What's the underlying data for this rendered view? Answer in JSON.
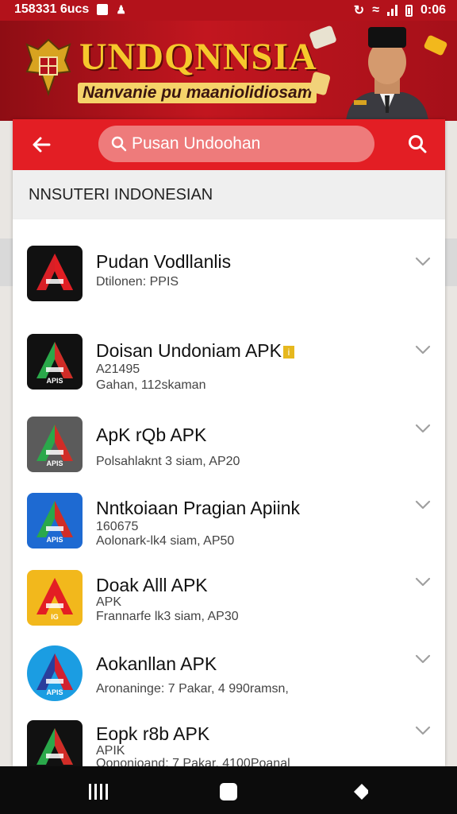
{
  "status_bar": {
    "left_text": "158331 6ucs",
    "time": "0:06"
  },
  "banner": {
    "title": "UNDQNNSIA",
    "subtitle": "Nanvanie pu maaniolidiosam"
  },
  "search": {
    "text": "Pusan Undoohan"
  },
  "section_header": "NNSUTERI INDONESIAN",
  "apps": [
    {
      "name": "Pudan Vodllanlis",
      "meta1": "Dtilonen: PPIS",
      "meta2": "",
      "badge": "",
      "icon_colors": [
        "#111111",
        "#d81f26"
      ],
      "icon_text": ""
    },
    {
      "name": "Doisan Undoniam APK",
      "meta1": "A21495",
      "meta2": "Gahan, 112skaman",
      "badge": "i",
      "icon_colors": [
        "#111111",
        "#2aa84a"
      ],
      "icon_text": "APIS"
    },
    {
      "name": "ApK rQb APK",
      "meta1": "",
      "meta2": "Polsahlaknt 3 siam, AP20",
      "badge": "",
      "icon_colors": [
        "#5b5b5b",
        "#2aa84a"
      ],
      "icon_text": "APIS"
    },
    {
      "name": "Nntkoiaan Pragian Apiink",
      "meta1": "160675",
      "meta2": "Aolonark-lk4 siam, AP50",
      "badge": "",
      "icon_colors": [
        "#1e6ad2",
        "#2aa84a"
      ],
      "icon_text": "APIS"
    },
    {
      "name": "Doak Alll APK",
      "meta1": "APK",
      "meta2": "Frannarfe lk3 siam, AP30",
      "badge": "",
      "icon_colors": [
        "#f2b81c",
        "#e31e24"
      ],
      "icon_text": "IG"
    },
    {
      "name": "Aokanllan APK",
      "meta1": "",
      "meta2": "Aronaninge: 7 Pakar, 4 990ramsn,",
      "badge": "",
      "icon_colors": [
        "#1b9de2",
        "#2a3e9c"
      ],
      "icon_text": "APIS"
    },
    {
      "name": "Eopk r8b APK",
      "meta1": "APIK",
      "meta2": "Oononioand: 7 Pakar, 4100Poanal",
      "badge": "",
      "icon_colors": [
        "#111111",
        "#2aa84a"
      ],
      "icon_text": ""
    }
  ],
  "colors": {
    "primary": "#e31e24",
    "banner": "#c2161f",
    "gold": "#f6c82c"
  }
}
